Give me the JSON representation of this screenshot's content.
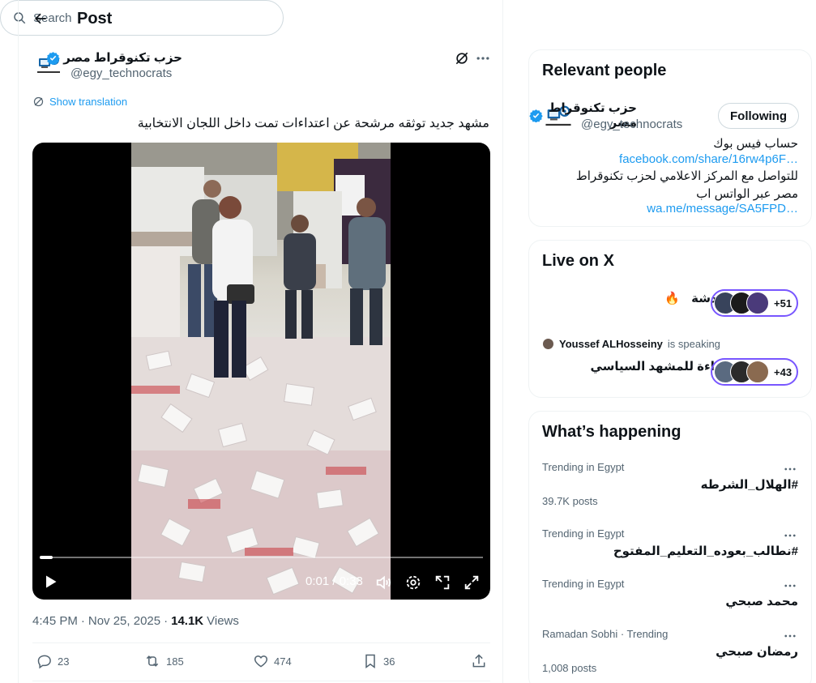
{
  "header": {
    "title": "Post"
  },
  "post": {
    "author_name": "حزب تكنوقراط مصر",
    "author_handle": "@egy_technocrats",
    "show_translation": "Show translation",
    "text": "مشهد جديد توثقه مرشحة عن اعتداءات تمت داخل اللجان الانتخابية",
    "video": {
      "time": "0:01 / 0:33",
      "progress_fraction": 0.03
    },
    "time": "4:45 PM",
    "dot": "·",
    "date": "Nov 25, 2025",
    "views_count": "14.1K",
    "views_label": "Views",
    "replies": "23",
    "reposts": "185",
    "likes": "474",
    "bookmarks": "36"
  },
  "search": {
    "placeholder": "Search"
  },
  "relevant_people": {
    "title": "Relevant people",
    "name": "حزب تكنوقراط مصر",
    "handle": "@egy_technocrats",
    "follow_label": "Following",
    "bio": [
      "حساب فيس بوك",
      "facebook.com/share/16rw4p6F…",
      "للتواصل مع المركز الاعلامي لحزب تكنوقراط",
      "مصر عبر الواتس اب",
      "wa.me/message/SA5FPD…"
    ]
  },
  "live": {
    "title": "Live on X",
    "spaces": [
      {
        "title": "دردشة",
        "emoji": "🔥",
        "count": "+51"
      },
      {
        "speaker": "Youssef ALHosseiny",
        "speaking": "is speaking",
        "title": "قراءة للمشهد السياسي",
        "count": "+43"
      }
    ]
  },
  "trends": {
    "title": "What’s happening",
    "items": [
      {
        "context": "Trending in Egypt",
        "name": "#الهلال_الشرطه",
        "count": "39.7K posts"
      },
      {
        "context": "Trending in Egypt",
        "name": "#نطالب_بعوده_التعليم_المفتوح",
        "count": ""
      },
      {
        "context": "Trending in Egypt",
        "name": "محمد صبحي",
        "count": ""
      },
      {
        "context": "Ramadan Sobhi · Trending",
        "name": "رمضان صبحي",
        "count": "1,008 posts"
      }
    ]
  },
  "colors": {
    "accent": "#1d9bf0",
    "live_ring": "#7856ff",
    "verified": "#1d9bf0"
  }
}
